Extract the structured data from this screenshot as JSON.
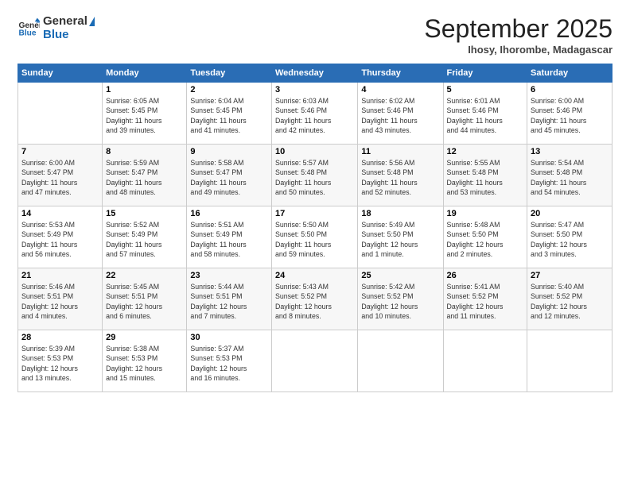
{
  "header": {
    "logo_line1": "General",
    "logo_line2": "Blue",
    "month": "September 2025",
    "location": "Ihosy, Ihorombe, Madagascar"
  },
  "columns": [
    "Sunday",
    "Monday",
    "Tuesday",
    "Wednesday",
    "Thursday",
    "Friday",
    "Saturday"
  ],
  "weeks": [
    [
      {
        "day": "",
        "info": ""
      },
      {
        "day": "1",
        "info": "Sunrise: 6:05 AM\nSunset: 5:45 PM\nDaylight: 11 hours\nand 39 minutes."
      },
      {
        "day": "2",
        "info": "Sunrise: 6:04 AM\nSunset: 5:45 PM\nDaylight: 11 hours\nand 41 minutes."
      },
      {
        "day": "3",
        "info": "Sunrise: 6:03 AM\nSunset: 5:46 PM\nDaylight: 11 hours\nand 42 minutes."
      },
      {
        "day": "4",
        "info": "Sunrise: 6:02 AM\nSunset: 5:46 PM\nDaylight: 11 hours\nand 43 minutes."
      },
      {
        "day": "5",
        "info": "Sunrise: 6:01 AM\nSunset: 5:46 PM\nDaylight: 11 hours\nand 44 minutes."
      },
      {
        "day": "6",
        "info": "Sunrise: 6:00 AM\nSunset: 5:46 PM\nDaylight: 11 hours\nand 45 minutes."
      }
    ],
    [
      {
        "day": "7",
        "info": "Sunrise: 6:00 AM\nSunset: 5:47 PM\nDaylight: 11 hours\nand 47 minutes."
      },
      {
        "day": "8",
        "info": "Sunrise: 5:59 AM\nSunset: 5:47 PM\nDaylight: 11 hours\nand 48 minutes."
      },
      {
        "day": "9",
        "info": "Sunrise: 5:58 AM\nSunset: 5:47 PM\nDaylight: 11 hours\nand 49 minutes."
      },
      {
        "day": "10",
        "info": "Sunrise: 5:57 AM\nSunset: 5:48 PM\nDaylight: 11 hours\nand 50 minutes."
      },
      {
        "day": "11",
        "info": "Sunrise: 5:56 AM\nSunset: 5:48 PM\nDaylight: 11 hours\nand 52 minutes."
      },
      {
        "day": "12",
        "info": "Sunrise: 5:55 AM\nSunset: 5:48 PM\nDaylight: 11 hours\nand 53 minutes."
      },
      {
        "day": "13",
        "info": "Sunrise: 5:54 AM\nSunset: 5:48 PM\nDaylight: 11 hours\nand 54 minutes."
      }
    ],
    [
      {
        "day": "14",
        "info": "Sunrise: 5:53 AM\nSunset: 5:49 PM\nDaylight: 11 hours\nand 56 minutes."
      },
      {
        "day": "15",
        "info": "Sunrise: 5:52 AM\nSunset: 5:49 PM\nDaylight: 11 hours\nand 57 minutes."
      },
      {
        "day": "16",
        "info": "Sunrise: 5:51 AM\nSunset: 5:49 PM\nDaylight: 11 hours\nand 58 minutes."
      },
      {
        "day": "17",
        "info": "Sunrise: 5:50 AM\nSunset: 5:50 PM\nDaylight: 11 hours\nand 59 minutes."
      },
      {
        "day": "18",
        "info": "Sunrise: 5:49 AM\nSunset: 5:50 PM\nDaylight: 12 hours\nand 1 minute."
      },
      {
        "day": "19",
        "info": "Sunrise: 5:48 AM\nSunset: 5:50 PM\nDaylight: 12 hours\nand 2 minutes."
      },
      {
        "day": "20",
        "info": "Sunrise: 5:47 AM\nSunset: 5:50 PM\nDaylight: 12 hours\nand 3 minutes."
      }
    ],
    [
      {
        "day": "21",
        "info": "Sunrise: 5:46 AM\nSunset: 5:51 PM\nDaylight: 12 hours\nand 4 minutes."
      },
      {
        "day": "22",
        "info": "Sunrise: 5:45 AM\nSunset: 5:51 PM\nDaylight: 12 hours\nand 6 minutes."
      },
      {
        "day": "23",
        "info": "Sunrise: 5:44 AM\nSunset: 5:51 PM\nDaylight: 12 hours\nand 7 minutes."
      },
      {
        "day": "24",
        "info": "Sunrise: 5:43 AM\nSunset: 5:52 PM\nDaylight: 12 hours\nand 8 minutes."
      },
      {
        "day": "25",
        "info": "Sunrise: 5:42 AM\nSunset: 5:52 PM\nDaylight: 12 hours\nand 10 minutes."
      },
      {
        "day": "26",
        "info": "Sunrise: 5:41 AM\nSunset: 5:52 PM\nDaylight: 12 hours\nand 11 minutes."
      },
      {
        "day": "27",
        "info": "Sunrise: 5:40 AM\nSunset: 5:52 PM\nDaylight: 12 hours\nand 12 minutes."
      }
    ],
    [
      {
        "day": "28",
        "info": "Sunrise: 5:39 AM\nSunset: 5:53 PM\nDaylight: 12 hours\nand 13 minutes."
      },
      {
        "day": "29",
        "info": "Sunrise: 5:38 AM\nSunset: 5:53 PM\nDaylight: 12 hours\nand 15 minutes."
      },
      {
        "day": "30",
        "info": "Sunrise: 5:37 AM\nSunset: 5:53 PM\nDaylight: 12 hours\nand 16 minutes."
      },
      {
        "day": "",
        "info": ""
      },
      {
        "day": "",
        "info": ""
      },
      {
        "day": "",
        "info": ""
      },
      {
        "day": "",
        "info": ""
      }
    ]
  ]
}
